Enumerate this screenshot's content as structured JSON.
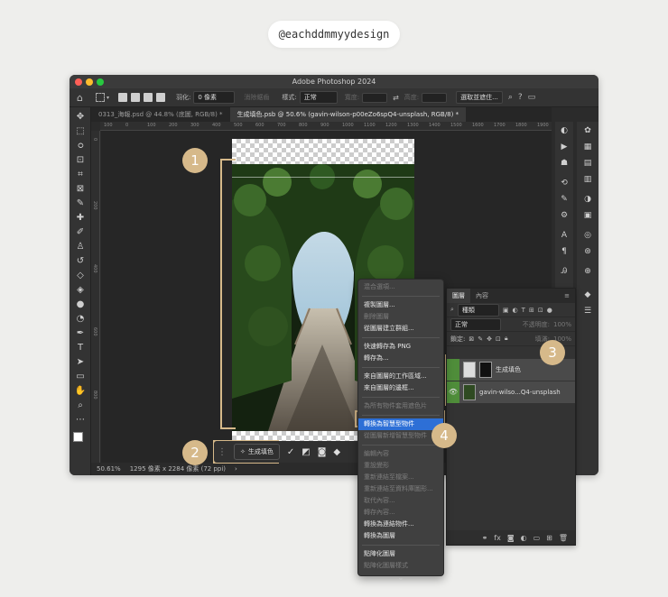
{
  "watermark": "@eachddmmyydesign",
  "app": {
    "title": "Adobe Photoshop 2024"
  },
  "options_bar": {
    "feather_label": "羽化:",
    "feather_value": "0 像素",
    "antialias_label": "消除鋸齒",
    "style_label": "樣式:",
    "style_value": "正常",
    "width_label": "寬度:",
    "height_label": "高度:",
    "select_mask_button": "選取並遮住..."
  },
  "tabs": [
    {
      "label": "0313_海報.psd @ 44.8% (底圖, RGB/8) *"
    },
    {
      "label": "生成填色.psb @ 50.6% (gavin-wilson-p00eZo6spQ4-unsplash, RGB/8) *"
    }
  ],
  "ruler": {
    "h_ticks": [
      "100",
      "0",
      "100",
      "200",
      "300",
      "400",
      "500",
      "600",
      "700",
      "800",
      "900",
      "1000",
      "1100",
      "1200",
      "1300",
      "1400",
      "1500",
      "1600",
      "1700",
      "1800",
      "1900"
    ],
    "v_ticks": [
      "0",
      "200",
      "400",
      "600",
      "800"
    ]
  },
  "status": {
    "zoom": "50.61%",
    "doc_info": "1295 像素 x 2284 像素 (72 ppi)"
  },
  "context_toolbar": {
    "generate_label": "生成填色"
  },
  "badges": [
    "1",
    "2",
    "3",
    "4"
  ],
  "layers_panel": {
    "tabs": [
      "圖層",
      "內容"
    ],
    "filter_label": "種類",
    "blend_mode": "正常",
    "opacity_label": "不透明度:",
    "opacity_value": "100%",
    "lock_label": "鎖定:",
    "fill_label": "填滿:",
    "fill_value": "100%",
    "layers": [
      {
        "name": "生成填色"
      },
      {
        "name": "gavin-wilso...Q4-unsplash"
      }
    ]
  },
  "context_menu": {
    "items": [
      {
        "label": "混合選項...",
        "disabled": true
      },
      {
        "sep": true
      },
      {
        "label": "複製圖層...",
        "disabled": false
      },
      {
        "label": "刪除圖層",
        "disabled": true
      },
      {
        "label": "從圖層建立群組...",
        "disabled": false
      },
      {
        "sep": true
      },
      {
        "label": "快速轉存為 PNG",
        "disabled": false
      },
      {
        "label": "轉存為...",
        "disabled": false
      },
      {
        "sep": true
      },
      {
        "label": "來自圖層的工作區域...",
        "disabled": false
      },
      {
        "label": "來自圖層的邊框...",
        "disabled": false
      },
      {
        "sep": true
      },
      {
        "label": "為所有物件套用遮色片",
        "disabled": true
      },
      {
        "sep": true
      },
      {
        "label": "轉換為智慧型物件",
        "disabled": false,
        "highlight": true
      },
      {
        "label": "從圖層新增智慧型物件",
        "disabled": true
      },
      {
        "sep": true
      },
      {
        "label": "編輯內容",
        "disabled": true
      },
      {
        "label": "重設變形",
        "disabled": true
      },
      {
        "label": "重新連結至檔案...",
        "disabled": true
      },
      {
        "label": "重新連結至資料庫圖形...",
        "disabled": true
      },
      {
        "label": "取代內容...",
        "disabled": true
      },
      {
        "label": "轉存內容...",
        "disabled": true
      },
      {
        "label": "轉換為連結物件...",
        "disabled": false
      },
      {
        "label": "轉換為圖層",
        "disabled": false
      },
      {
        "sep": true
      },
      {
        "label": "點陣化圖層",
        "disabled": false
      },
      {
        "label": "點陣化圖層樣式",
        "disabled": true
      }
    ],
    "more_icon": "chevron-down-icon"
  },
  "colors": {
    "accent": "#d6b98a",
    "highlight": "#2d6fd6"
  }
}
